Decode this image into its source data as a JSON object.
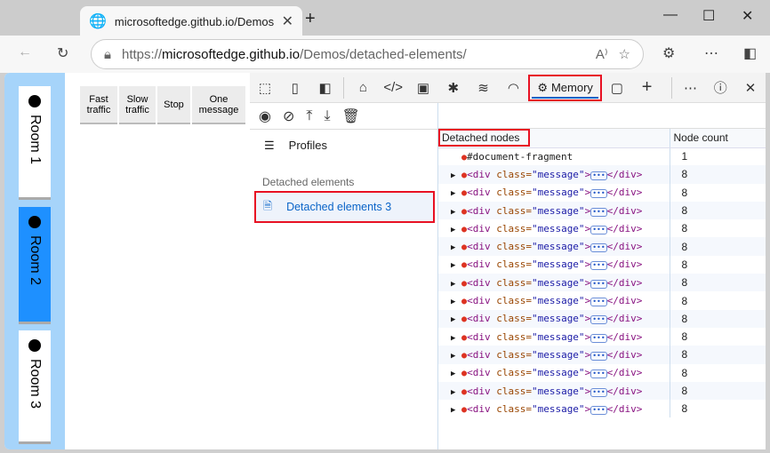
{
  "browser": {
    "tab_title": "microsoftedge.github.io/Demos/detached-elements/",
    "url_prefix": "https://",
    "url_domain": "microsoftedge.github.io",
    "url_path": "/Demos/detached-elements/"
  },
  "page": {
    "rooms": [
      {
        "label": "Room 1",
        "active": false
      },
      {
        "label": "Room 2",
        "active": true
      },
      {
        "label": "Room 3",
        "active": false
      }
    ],
    "buttons": [
      [
        "Fast",
        "traffic"
      ],
      [
        "Slow",
        "traffic"
      ],
      [
        "Stop",
        ""
      ],
      [
        "One",
        "message"
      ]
    ]
  },
  "devtools": {
    "active_tab": "Memory",
    "profiles_label": "Profiles",
    "section_label": "Detached elements",
    "profile_item": "Detached elements 3",
    "table": {
      "headers": [
        "Detached nodes",
        "Node count"
      ],
      "first_row": {
        "node": "#document-fragment",
        "count": "1"
      },
      "row_tag_open": "<div",
      "row_attr": "class=",
      "row_val": "\"message\"",
      "row_close": "></div>",
      "row_count": "8",
      "row_repeat": 14
    }
  },
  "colors": {
    "accent": "#0a64c8",
    "highlight": "#e81123",
    "room_active": "#1e90ff",
    "room_bar": "#a6d4fa"
  }
}
